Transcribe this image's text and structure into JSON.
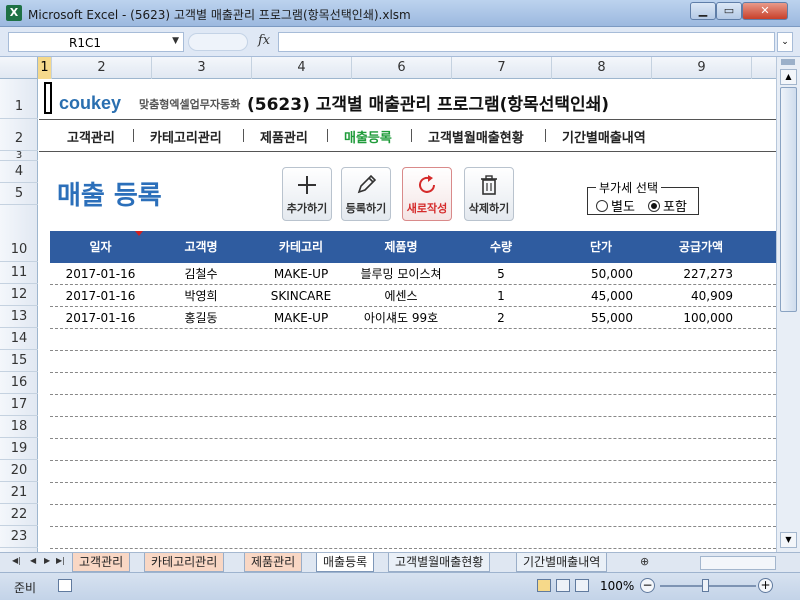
{
  "window": {
    "title": "Microsoft Excel - (5623) 고객별 매출관리 프로그램(항목선택인쇄).xlsm",
    "app_icon": "X"
  },
  "formula_bar": {
    "name_box": "R1C1",
    "fx": "fx",
    "formula": ""
  },
  "columns": [
    "1",
    "2",
    "3",
    "4",
    "6",
    "7",
    "8",
    "9"
  ],
  "rows": [
    "1",
    "2",
    "3",
    "4",
    "5",
    "10",
    "11",
    "12",
    "13",
    "14",
    "15",
    "16",
    "17",
    "18",
    "19",
    "20",
    "21",
    "22",
    "23"
  ],
  "header": {
    "logo": "coukey",
    "logo_sub": "맞춤형엑셀업무자동화",
    "program_title": "(5623) 고객별 매출관리 프로그램(항목선택인쇄)"
  },
  "nav": [
    "고객관리",
    "카테고리관리",
    "제품관리",
    "매출등록",
    "고객별월매출현황",
    "기간별매출내역"
  ],
  "nav_active": "매출등록",
  "page_title": "매출 등록",
  "actions": {
    "add": "추가하기",
    "register": "등록하기",
    "new": "새로작성",
    "delete": "삭제하기"
  },
  "vat": {
    "legend": "부가세 선택",
    "opt_separate": "별도",
    "opt_include": "포함",
    "selected": "포함"
  },
  "table": {
    "headers": [
      "일자",
      "고객명",
      "카테고리",
      "제품명",
      "수량",
      "단가",
      "공급가액"
    ],
    "rows": [
      [
        "2017-01-16",
        "김철수",
        "MAKE-UP",
        "블루밍 모이스쳐",
        "5",
        "50,000",
        "227,273"
      ],
      [
        "2017-01-16",
        "박영희",
        "SKINCARE",
        "에센스",
        "1",
        "45,000",
        "40,909"
      ],
      [
        "2017-01-16",
        "홍길동",
        "MAKE-UP",
        "아이섀도 99호",
        "2",
        "55,000",
        "100,000"
      ]
    ],
    "empty_rows": 10
  },
  "sheet_tabs": [
    "고객관리",
    "카테고리관리",
    "제품관리",
    "매출등록",
    "고객별월매출현황",
    "기간별매출내역"
  ],
  "active_tab": "매출등록",
  "status": {
    "ready": "준비",
    "zoom": "100%"
  },
  "colors": {
    "table_header": "#2f5ca0",
    "page_title": "#2b6fba",
    "nav_active": "#1f9b3a",
    "new_button": "#d52b2b"
  }
}
